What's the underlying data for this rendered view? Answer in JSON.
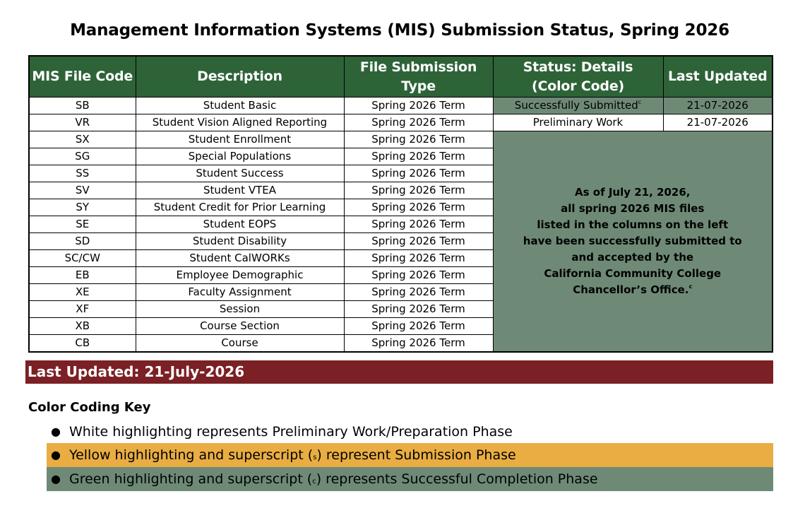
{
  "title": "Management Information Systems (MIS) Submission Status, Spring 2026",
  "table": {
    "headers": {
      "code": "MIS File Code",
      "description": "Description",
      "type_line1": "File Submission",
      "type_line2": "Type",
      "status_line1": "Status: Details",
      "status_line2": "(Color Code)",
      "last_updated": "Last Updated"
    },
    "rows": [
      {
        "code": "SB",
        "description": "Student Basic",
        "type": "Spring 2026 Term",
        "status": "Successfully Submitted",
        "status_sup": "c",
        "updated": "21-07-2026"
      },
      {
        "code": "VR",
        "description": "Student Vision Aligned Reporting",
        "type": "Spring 2026 Term",
        "status": "Preliminary Work",
        "updated": "21-07-2026"
      },
      {
        "code": "SX",
        "description": "Student Enrollment",
        "type": "Spring 2026 Term"
      },
      {
        "code": "SG",
        "description": "Special Populations",
        "type": "Spring 2026 Term"
      },
      {
        "code": "SS",
        "description": "Student Success",
        "type": "Spring 2026 Term"
      },
      {
        "code": "SV",
        "description": "Student VTEA",
        "type": "Spring 2026 Term"
      },
      {
        "code": "SY",
        "description": "Student Credit for Prior Learning",
        "type": "Spring 2026 Term"
      },
      {
        "code": "SE",
        "description": "Student EOPS",
        "type": "Spring 2026 Term"
      },
      {
        "code": "SD",
        "description": "Student Disability",
        "type": "Spring 2026 Term"
      },
      {
        "code": "SC/CW",
        "description": "Student CalWORKs",
        "type": "Spring 2026 Term"
      },
      {
        "code": "EB",
        "description": "Employee Demographic",
        "type": "Spring 2026 Term"
      },
      {
        "code": "XE",
        "description": "Faculty Assignment",
        "type": "Spring 2026 Term"
      },
      {
        "code": "XF",
        "description": "Session",
        "type": "Spring 2026 Term"
      },
      {
        "code": "XB",
        "description": "Course Section",
        "type": "Spring 2026 Term"
      },
      {
        "code": "CB",
        "description": "Course",
        "type": "Spring 2026 Term"
      }
    ],
    "merged_note": {
      "lines": [
        "As of July 21, 2026,",
        "all spring 2026 MIS files",
        "listed in the columns on the left",
        "have been successfully submitted to",
        "and accepted by the",
        "California Community College",
        "Chancellor’s Office."
      ],
      "sup": "c"
    }
  },
  "last_updated_bar": "Last Updated: 21-July-2026",
  "key": {
    "title": "Color Coding Key",
    "items": [
      {
        "before": "White highlighting represents Preliminary Work/Preparation Phase",
        "sup": "",
        "after": "",
        "color": "#ffffff"
      },
      {
        "before": "Yellow highlighting and superscript (",
        "sup": "s",
        "after": ") represent Submission Phase",
        "color": "#e9ad43"
      },
      {
        "before": "Green highlighting and superscript (",
        "sup": "c",
        "after": ") represents Successful Completion Phase",
        "color": "#6e8a76"
      }
    ]
  },
  "colors": {
    "header_green": "#2e6338",
    "status_green": "#6e8a76",
    "last_updated_maroon": "#7b2025",
    "yellow": "#e9ad43"
  }
}
